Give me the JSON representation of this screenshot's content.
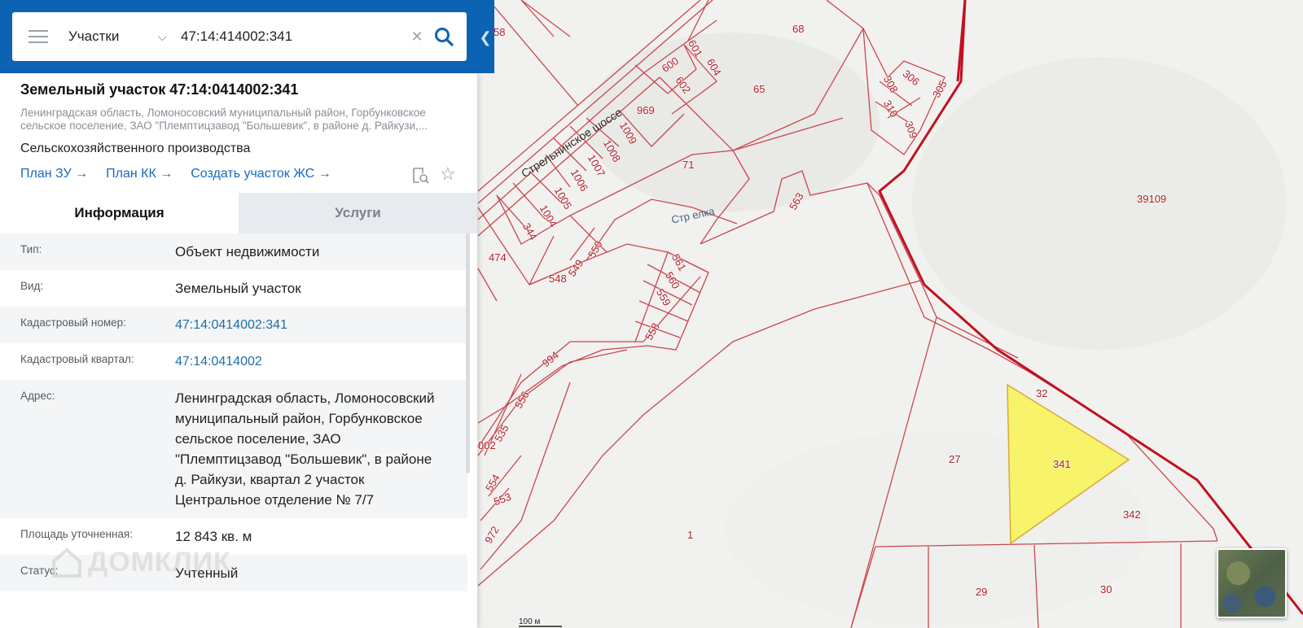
{
  "search": {
    "category": "Участки",
    "query": "47:14:414002:341"
  },
  "object": {
    "title": "Земельный участок 47:14:0414002:341",
    "address_short": "Ленинградская область, Ломоносовский муниципальный район, Горбунковское сельское поселение, ЗАО \"Племптицзавод \"Большевик\", в районе д. Райкузи,...",
    "purpose": "Сельскохозяйственного производства",
    "links": [
      "План ЗУ →",
      "План КК →",
      "Создать участок ЖС →"
    ]
  },
  "tabs": {
    "info": "Информация",
    "services": "Услуги"
  },
  "info_rows": [
    {
      "key": "Тип:",
      "value": "Объект недвижимости"
    },
    {
      "key": "Вид:",
      "value": "Земельный участок"
    },
    {
      "key": "Кадастровый номер:",
      "value": "47:14:0414002:341"
    },
    {
      "key": "Кадастровый квартал:",
      "value": "47:14:0414002"
    },
    {
      "key": "Адрес:",
      "value": "Ленинградская область, Ломоносовский муниципальный район, Горбунковское сельское поселение, ЗАО \"Племптицзавод \"Большевик\", в районе д. Райкузи, квартал 2 участок Центральное отделение № 7/7"
    },
    {
      "key": "Площадь уточненная:",
      "value": "12 843 кв. м"
    },
    {
      "key": "Статус:",
      "value": "Учтенный"
    }
  ],
  "watermark": "ДОМКЛИК",
  "map": {
    "road_label": "Стрельнинское шоссе",
    "street_label": "Стр   елка",
    "scale_label": "100 м",
    "plot_labels": [
      "58",
      "68",
      "601",
      "604",
      "600",
      "602",
      "65",
      "306",
      "308",
      "305",
      "310",
      "309",
      "969",
      "1009",
      "1008",
      "1007",
      "1006",
      "1005",
      "1004",
      "71",
      "563",
      "39109",
      "474",
      "344",
      "550",
      "549",
      "548",
      "561",
      "560",
      "559",
      "558",
      "994",
      "556",
      "535",
      "002",
      "554",
      "553",
      "972",
      "32",
      "341",
      "27",
      "342",
      "1",
      "29",
      "30"
    ],
    "highlight_color": "#f7f36a",
    "boundary_color": "#c0121f"
  }
}
